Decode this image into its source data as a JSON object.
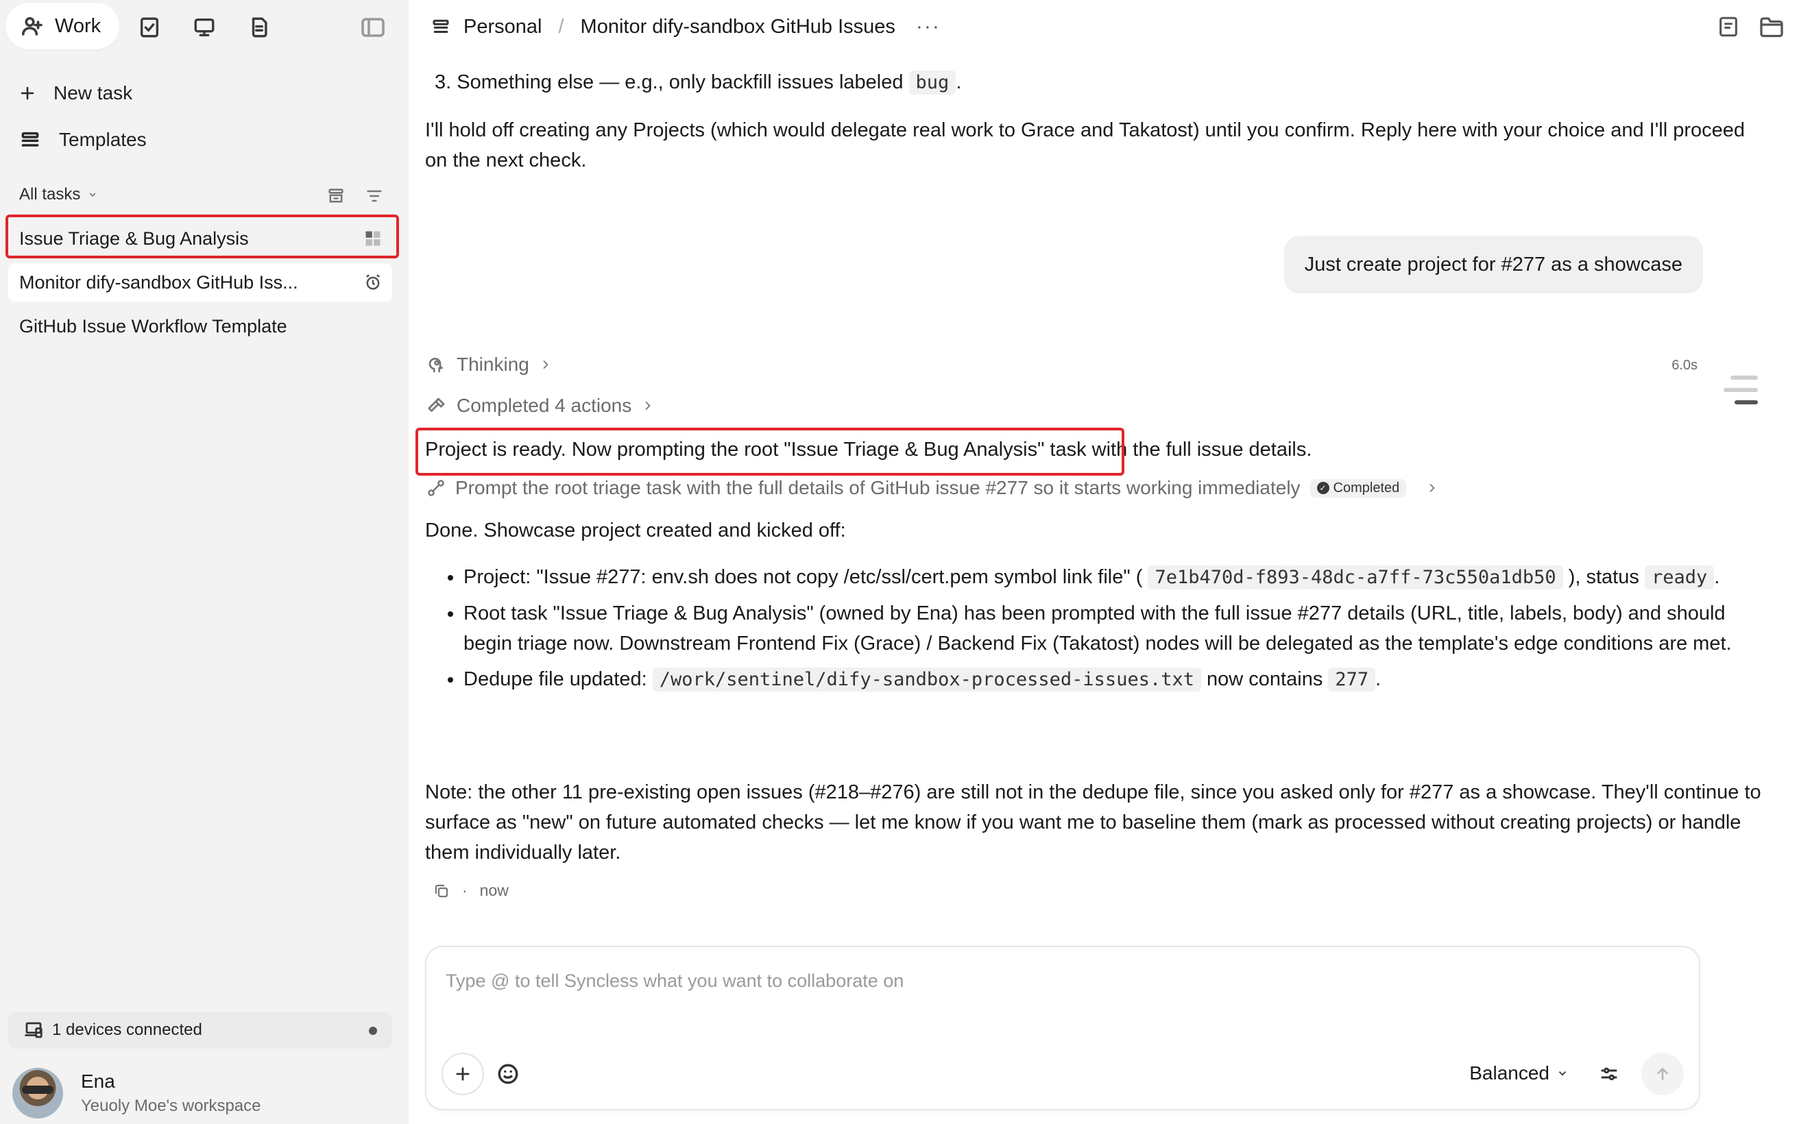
{
  "sidebar": {
    "nav": {
      "work_label": "Work",
      "icons": [
        "users-icon",
        "checklist-icon",
        "monitor-icon",
        "document-icon",
        "sidebar-toggle-icon"
      ]
    },
    "new_task_label": "New task",
    "templates_label": "Templates",
    "all_tasks_label": "All tasks",
    "tasks": [
      {
        "label": "Issue Triage & Bug Analysis",
        "icon": "grid-icon",
        "selected": false
      },
      {
        "label": "Monitor dify-sandbox GitHub Iss...",
        "icon": "alarm-icon",
        "selected": true
      },
      {
        "label": "GitHub Issue Workflow Template",
        "icon": "",
        "selected": false
      }
    ],
    "devices_label": "1 devices connected",
    "user": {
      "name": "Ena",
      "workspace": "Yeuoly Moe's workspace"
    }
  },
  "header": {
    "crumb_root": "Personal",
    "crumb_sep": "/",
    "crumb_current": "Monitor dify-sandbox GitHub Issues",
    "more": "···"
  },
  "conversation": {
    "option3_prefix": "3.  Something else — e.g., only backfill issues labeled",
    "option3_code": "bug",
    "option3_suffix": ".",
    "hold_text": "I'll hold off creating any Projects (which would delegate real work to Grace and Takatost) until you confirm. Reply here with your choice and I'll proceed on the next check.",
    "user_message": "Just create project for #277 as a showcase",
    "thinking_label": "Thinking",
    "thinking_time": "6.0s",
    "actions_label": "Completed 4 actions",
    "highlight_text": "Project is ready. Now prompting the root \"Issue Triage & Bug Analysis\" task with the full issue details.",
    "prompt_action": "Prompt the root triage task with the full details of GitHub issue #277 so it starts working immediately",
    "completed_badge": "Completed",
    "done_text": "Done. Showcase project created and kicked off:",
    "bullet1_a": "Project: \"Issue #277: env.sh does not copy /etc/ssl/cert.pem symbol link file\" (",
    "bullet1_code": "7e1b470d-f893-48dc-a7ff-73c550a1db50",
    "bullet1_b": "), status",
    "bullet1_code2": "ready",
    "bullet1_c": ".",
    "bullet2": "Root task \"Issue Triage & Bug Analysis\" (owned by Ena) has been prompted with the full issue #277 details (URL, title, labels, body) and should begin triage now. Downstream Frontend Fix (Grace) / Backend Fix (Takatost) nodes will be delegated as the template's edge conditions are met.",
    "bullet3_a": "Dedupe file updated:",
    "bullet3_code": "/work/sentinel/dify-sandbox-processed-issues.txt",
    "bullet3_b": "now contains",
    "bullet3_code2": "277",
    "bullet3_c": ".",
    "note_text": "Note: the other 11 pre-existing open issues (#218–#276) are still not in the dedupe file, since you asked only for #277 as a showcase. They'll continue to surface as \"new\" on future automated checks — let me know if you want me to baseline them (mark as processed without creating projects) or handle them individually later.",
    "footer_sep": "·",
    "footer_time": "now"
  },
  "composer": {
    "placeholder": "Type @ to tell Syncless what you want to collaborate on",
    "mode_label": "Balanced"
  },
  "colors": {
    "highlight": "#e0262b",
    "sidebar_bg": "#f3f3f3"
  }
}
